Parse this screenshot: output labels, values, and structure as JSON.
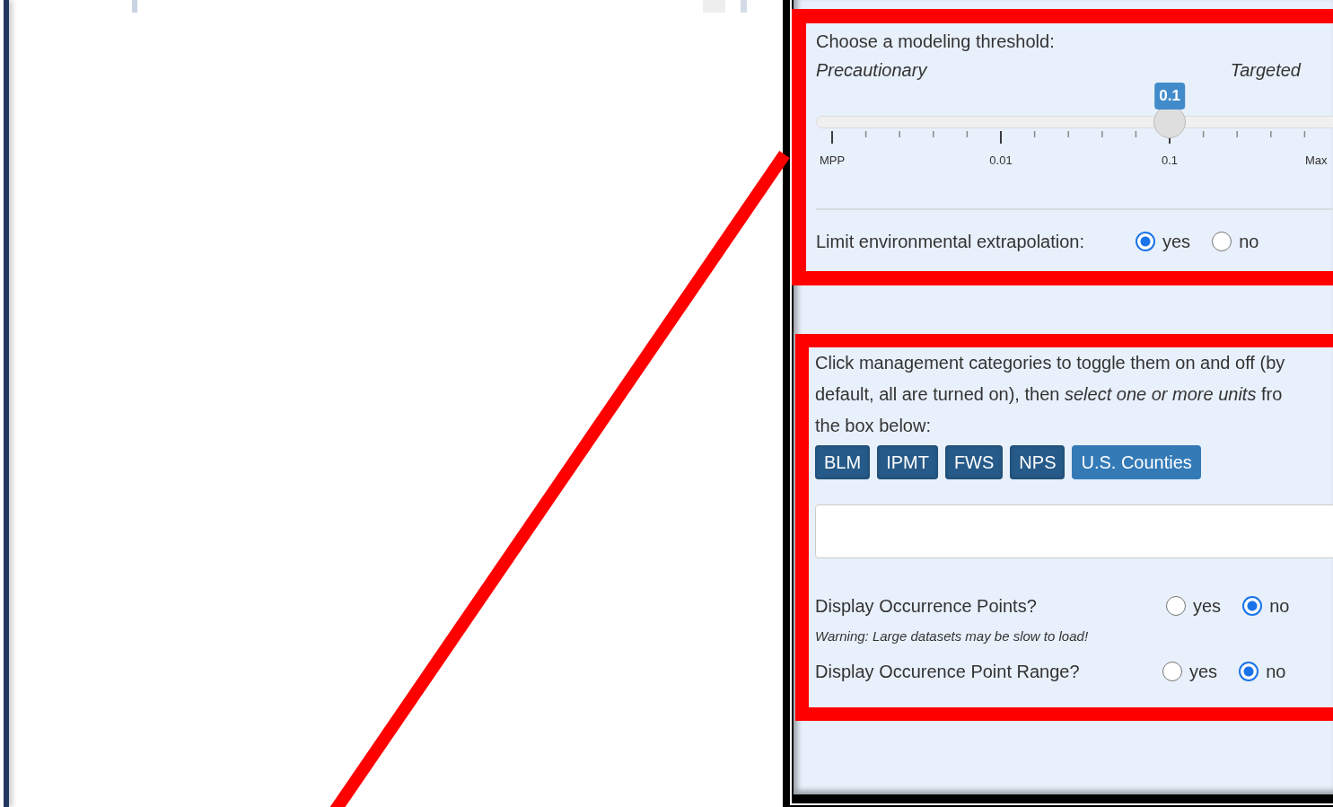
{
  "threshold": {
    "label": "Choose a modeling threshold:",
    "left_label": "Precautionary",
    "right_label": "Targeted",
    "slider": {
      "value": "0.1",
      "level": 0.667,
      "ticks": [
        "MPP",
        "0.01",
        "0.1",
        "Max"
      ]
    }
  },
  "extrapolation": {
    "label": "Limit environmental extrapolation:",
    "options": [
      {
        "label": "yes",
        "selected": true
      },
      {
        "label": "no",
        "selected": false
      }
    ]
  },
  "management": {
    "instructions": [
      "Click management categories to toggle them on and off (by",
      "default, all are turned on), then *select one or more units* fro",
      "the box below:"
    ],
    "categories": [
      {
        "label": "BLM",
        "on": true
      },
      {
        "label": "IPMT",
        "on": true
      },
      {
        "label": "FWS",
        "on": true
      },
      {
        "label": "NPS",
        "on": true
      },
      {
        "label": "U.S. Counties",
        "on": false
      }
    ]
  },
  "occurrence_points": {
    "label": "Display Occurrence Points?",
    "warning": "Warning: Large datasets may be slow to load!",
    "options": [
      {
        "label": "yes",
        "selected": false
      },
      {
        "label": "no",
        "selected": true
      }
    ]
  },
  "point_range": {
    "label": "Display Occurence Point Range?",
    "options": [
      {
        "label": "yes",
        "selected": false
      },
      {
        "label": "no",
        "selected": true
      }
    ]
  }
}
